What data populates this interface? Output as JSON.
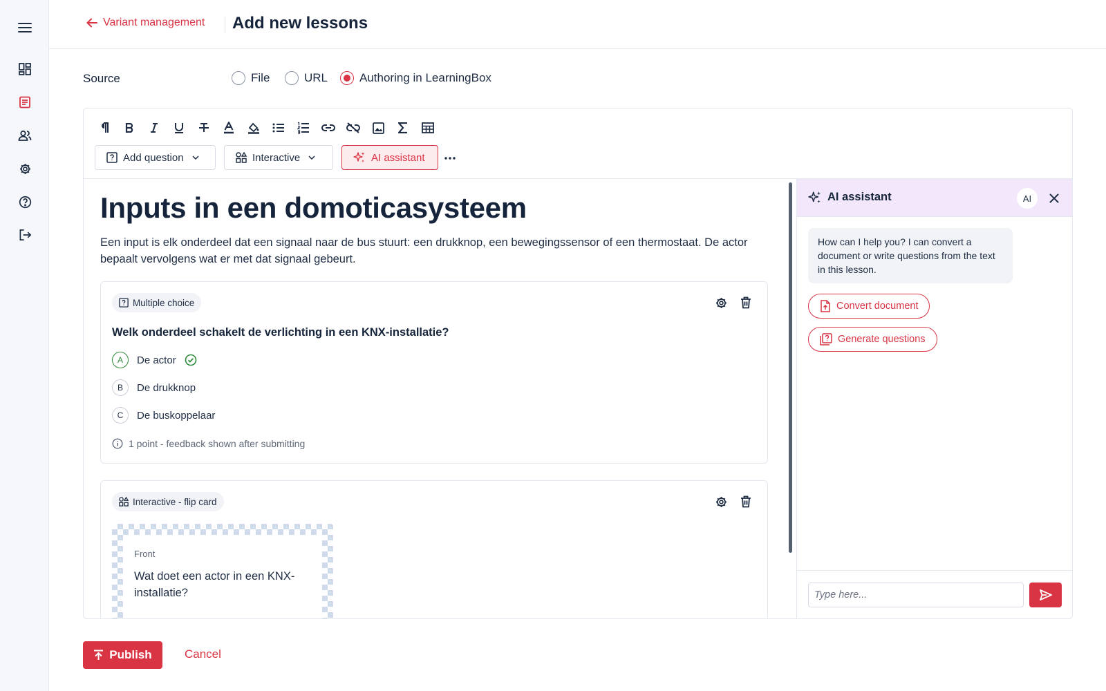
{
  "colors": {
    "accent": "#d93444",
    "success": "#2f8a3a",
    "ai_header_bg": "#f3e8fb",
    "text": "#1f2d44"
  },
  "sidebar": {
    "items": [
      {
        "icon": "menu-icon"
      },
      {
        "icon": "dashboard-icon"
      },
      {
        "icon": "lessons-icon",
        "active": true
      },
      {
        "icon": "users-icon"
      },
      {
        "icon": "settings-icon"
      },
      {
        "icon": "help-icon"
      },
      {
        "icon": "logout-icon"
      }
    ]
  },
  "header": {
    "back_label": "Variant management",
    "title": "Add new lessons"
  },
  "source": {
    "label": "Source",
    "options": [
      {
        "label": "File",
        "selected": false
      },
      {
        "label": "URL",
        "selected": false
      },
      {
        "label": "Authoring in LearningBox",
        "selected": true
      }
    ]
  },
  "toolbar": {
    "format_icons": [
      "paragraph-icon",
      "bold-icon",
      "italic-icon",
      "underline-icon",
      "strikethrough-icon",
      "text-color-icon",
      "highlight-icon",
      "bullet-list-icon",
      "numbered-list-icon",
      "link-icon",
      "unlink-icon",
      "image-icon",
      "formula-icon",
      "table-icon"
    ],
    "add_question_label": "Add question",
    "interactive_label": "Interactive",
    "ai_assistant_label": "AI assistant"
  },
  "lesson": {
    "title": "Inputs in een domoticasysteem",
    "body": "Een input is elk onderdeel dat een signaal naar de bus stuurt: een drukknop, een bewegingssensor of een thermostaat. De actor bepaalt vervolgens wat er met dat signaal gebeurt."
  },
  "question_card": {
    "badge": "Multiple choice",
    "question": "Welk onderdeel schakelt de verlichting in een KNX-installatie?",
    "answers": [
      {
        "letter": "A",
        "text": "De actor",
        "correct": true
      },
      {
        "letter": "B",
        "text": "De drukknop",
        "correct": false
      },
      {
        "letter": "C",
        "text": "De buskoppelaar",
        "correct": false
      }
    ],
    "info": "1 point - feedback shown after submitting"
  },
  "flip_card": {
    "badge": "Interactive - flip card",
    "front_label": "Front",
    "front_text": "Wat doet een actor in een KNX-installatie?"
  },
  "ai_panel": {
    "title": "AI assistant",
    "avatar": "AI",
    "message": "How can I help you? I can convert a document or write questions from the text in this lesson.",
    "convert_label": "Convert document",
    "generate_label": "Generate questions",
    "input_placeholder": "Type here..."
  },
  "footer": {
    "publish_label": "Publish",
    "cancel_label": "Cancel"
  }
}
